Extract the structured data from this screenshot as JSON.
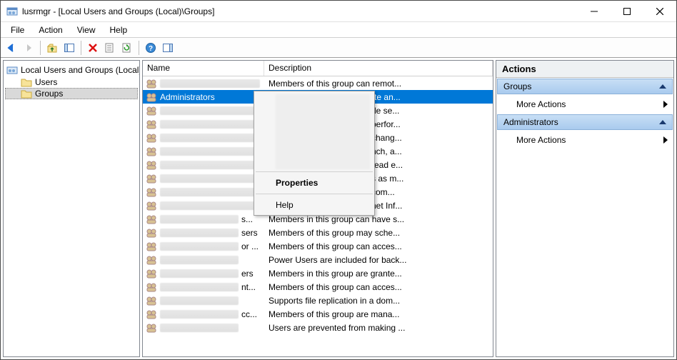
{
  "window": {
    "title": "lusrmgr - [Local Users and Groups (Local)\\Groups]"
  },
  "menu": {
    "file": "File",
    "action": "Action",
    "view": "View",
    "help": "Help"
  },
  "tree": {
    "root": "Local Users and Groups (Local)",
    "users": "Users",
    "groups": "Groups"
  },
  "list": {
    "col_name": "Name",
    "col_desc": "Description",
    "rows": [
      {
        "name_hidden": true,
        "desc": "Members of this group can remot...",
        "selected": false
      },
      {
        "name": "Administrators",
        "desc": "Administrators have complete an...",
        "selected": true
      },
      {
        "name_hidden": true,
        "desc": "de se...",
        "obscured": true
      },
      {
        "name_hidden": true,
        "desc": "perfor...",
        "obscured": true
      },
      {
        "name_hidden": true,
        "desc": "chang...",
        "obscured": true
      },
      {
        "name_hidden": true,
        "desc": "nch, a...",
        "obscured": true
      },
      {
        "name_hidden": true,
        "desc": "read e...",
        "obscured": true
      },
      {
        "name_hidden": true,
        "desc": "s as m...",
        "obscured": true
      },
      {
        "name_hidden": true,
        "desc": "com...",
        "obscured": true
      },
      {
        "name_hidden": true,
        "desc": "net Inf...",
        "obscured": true
      },
      {
        "name_hidden": true,
        "tail": "s...",
        "desc": "Members in this group can have s...",
        "obscured_partial": true
      },
      {
        "name_hidden": true,
        "tail": "sers",
        "desc": "Members of this group may sche..."
      },
      {
        "name_hidden": true,
        "tail": "or ...",
        "desc": "Members of this group can acces..."
      },
      {
        "name_hidden": true,
        "tail": "",
        "desc": "Power Users are included for back..."
      },
      {
        "name_hidden": true,
        "tail": "ers",
        "desc": "Members in this group are grante..."
      },
      {
        "name_hidden": true,
        "tail": "nt...",
        "desc": "Members of this group can acces..."
      },
      {
        "name_hidden": true,
        "tail": "",
        "desc": "Supports file replication in a dom..."
      },
      {
        "name_hidden": true,
        "tail": "cc...",
        "desc": "Members of this group are mana..."
      },
      {
        "name_hidden": true,
        "tail": "",
        "desc": "Users are prevented from making ..."
      }
    ]
  },
  "context_menu": {
    "properties": "Properties",
    "help": "Help"
  },
  "actions": {
    "header": "Actions",
    "section1": "Groups",
    "more1": "More Actions",
    "section2": "Administrators",
    "more2": "More Actions"
  }
}
